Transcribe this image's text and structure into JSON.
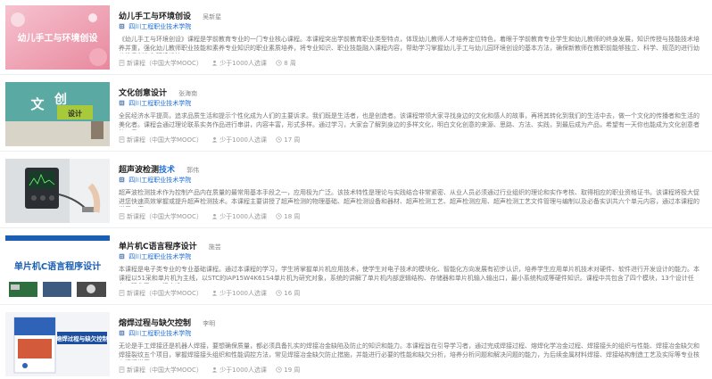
{
  "courses": [
    {
      "title": "幼儿手工与环境创设",
      "title_hl": "",
      "teacher": "吴新星",
      "school": "四川工程职业技术学院",
      "desc": "《幼儿手工与环境创设》课程是学前教育专业的一门专业核心课程。本课程突出学前教育职业类型特点，体现幼儿教师人才培养定位特色，着眼于学前教育专业学生和幼儿教师的终身发展，知识传授与技能技术培养并重，强化幼儿教师职业技能和素养专业知识的职业素质培养，将专业知识、职业技能融入课程内容，帮助学习掌握幼儿手工与幼儿园环境创设的基本方法，确保新教师在教职前能够独立、科学、规范的进行幼儿教具制作和环境设计。",
      "source": "新课程（中国大学MOOC）",
      "count": "少于1000人选课",
      "weeks": "8 周",
      "thumb_text": "幼儿手工与环境创设",
      "thumb_colors": [
        "#f2b7c4",
        "#e98fa3"
      ]
    },
    {
      "title": "文化创意设计",
      "title_hl": "",
      "teacher": "张海南",
      "school": "四川工程职业技术学院",
      "desc": "全民经济水平提高，追求品质生活和提示个性化成为人们的主要诉求。我们既是生活者，也是创造者。该课程带领大家寻找身边的文化和感人的故事，再将其转化到我们的生活中去，做一个文化的传播者和生活的美化者。课程会通过理论联系实务作品进行串讲，内容丰富，形式多样。通过学习，大家会了解到身边的多样文化，明白文化创意的来源、思路、方法、实践，到最后成为产品，希望有一天你也能成为文化创意者的一员。",
      "source": "新课程（中国大学MOOC）",
      "count": "少于1000人选课",
      "weeks": "17 周",
      "thumb_text": "文化创意设计",
      "thumb_colors": [
        "#5fb3ad",
        "#3c8c86"
      ]
    },
    {
      "title": "超声波检测",
      "title_hl": "技术",
      "teacher": "郭伟",
      "school": "四川工程职业技术学院",
      "desc": "超声波检测技术作为控制产品内在质量的最常用基本手段之一，应用极为广泛。该技术特性是理论与实践结合非常紧密、从业人员必须通过行业组织的理论和实作考核、取得相应的职业资格证书。该课程将极大促进您快速高效掌握或提升超声检测技术。本课程主要讲授了超声检测的物理基础、超声检测设备和器材、超声检测工艺、超声检测应用、超声检测工艺文件管理与编制以及必备实训共六个单元内容，通过本课程的学习，您...",
      "source": "新课程（中国大学MOOC）",
      "count": "少于1000人选课",
      "weeks": "18 周",
      "thumb_text": "",
      "thumb_colors": [
        "#cfd4d8",
        "#7d858c"
      ]
    },
    {
      "title": "单片机C语言程序设计",
      "title_hl": "",
      "teacher": "施芸",
      "school": "四川工程职业技术学院",
      "desc": "本课程是电子类专业的专业基础课程。通过本课程的学习，学生将掌握单片机应用技术，使学生对电子技术的模块化、智能化方向发展有初步认识，培养学生应用单片机技术对硬件、软件进行开发设计的能力。本课程以51采和单片机为主线，以STC的IAP15W4K61S4单片机为研究对象，系统的讲解了单片机内部逻辑结构、存储器和单片机输入输出口，最小系统构成等硬件知识。课程中共包含了四个模块，13个设计任务，强化了C51程序设...",
      "source": "新课程（中国大学MOOC）",
      "count": "少于1000人选课",
      "weeks": "16 周",
      "thumb_text": "单片机C语言程序设计",
      "thumb_colors": [
        "#ffffff",
        "#1a5fb4"
      ]
    },
    {
      "title": "熔焊过程与缺欠控制",
      "title_hl": "",
      "teacher": "李明",
      "school": "四川工程职业技术学院",
      "desc": "无论是手工焊接还是机器人焊接，要想确保质量，都必须具备扎实的焊接冶金缺陷及防止的知识和能力。本课程旨在引导学习者，通过完成焊接过程、熔焊化学冶金过程、焊接接头的组织与性能、焊接冶金缺欠和焊接裂纹五个项目，掌握焊接接头组织和性能调控方法，常见焊接冶金缺欠防止措施，并能进行必要的性能和缺欠分析，培养分析问题和解决问题的能力，为后续金属材料焊接、焊接结构制造工艺及实际等专业核心课程学习...",
      "source": "新课程（中国大学MOOC）",
      "count": "少于1000人选课",
      "weeks": "19 周",
      "thumb_text": "熔焊过程与缺欠控制",
      "thumb_colors": [
        "#eef2f7",
        "#2e63b8"
      ]
    }
  ]
}
